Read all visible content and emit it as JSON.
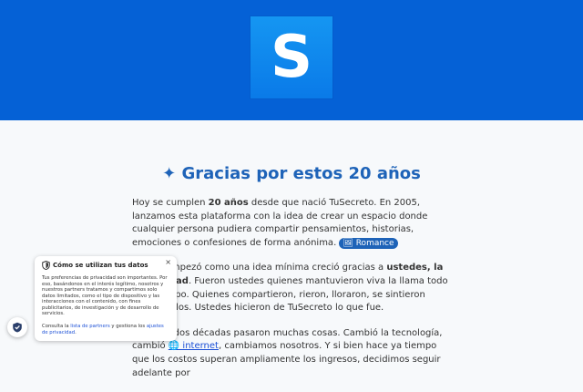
{
  "logo": {
    "letter": "S"
  },
  "title": "✦ Gracias por estos 20 años",
  "article": {
    "p1": [
      "Hoy se cumplen ",
      "20 años",
      " desde que nació TuSecreto. En 2005, lanzamos esta plataforma con la idea de crear un espacio donde cualquier persona pudiera compartir pensamientos, historias, emociones o confesiones de forma anónima. ",
      "🖼 Romance"
    ],
    "p2": [
      "Lo que empezó como una idea mínima creció gracias a ",
      "ustedes, la comunidad",
      ". Fueron ustedes quienes mantuvieron viva la llama todo este tiempo. Quienes compartieron, rieron, lloraron, se sintieron menos solos. Ustedes hicieron de TuSecreto lo que fue."
    ],
    "p3": [
      "En estas dos décadas pasaron muchas cosas. Cambió la tecnología, cambió ",
      "🌐 internet",
      ", cambiamos nosotros. Y si bien hace ya tiempo que los costos superan ampliamente los ingresos, decidimos seguir adelante por"
    ]
  },
  "consent": {
    "title": "Cómo se utilizan tus datos",
    "close": "×",
    "body": "Tus preferencias de privacidad son importantes. Por eso, basándonos en el interés legítimo, nosotros y nuestros partners tratamos y compartimos solo datos limitados, como el tipo de dispositivo y las interacciones con el contenido, con fines publicitarios, de investigación y de desarrollo de servicios.",
    "footer_prefix": "Consulta la ",
    "partners_link": "lista de partners",
    "footer_mid": " y gestiona los ",
    "privacy_link": "ajustes de privacidad",
    "footer_suffix": "."
  },
  "colors": {
    "header": "#0561d6",
    "accent": "#1e63b8",
    "link": "#1a4fd6"
  }
}
